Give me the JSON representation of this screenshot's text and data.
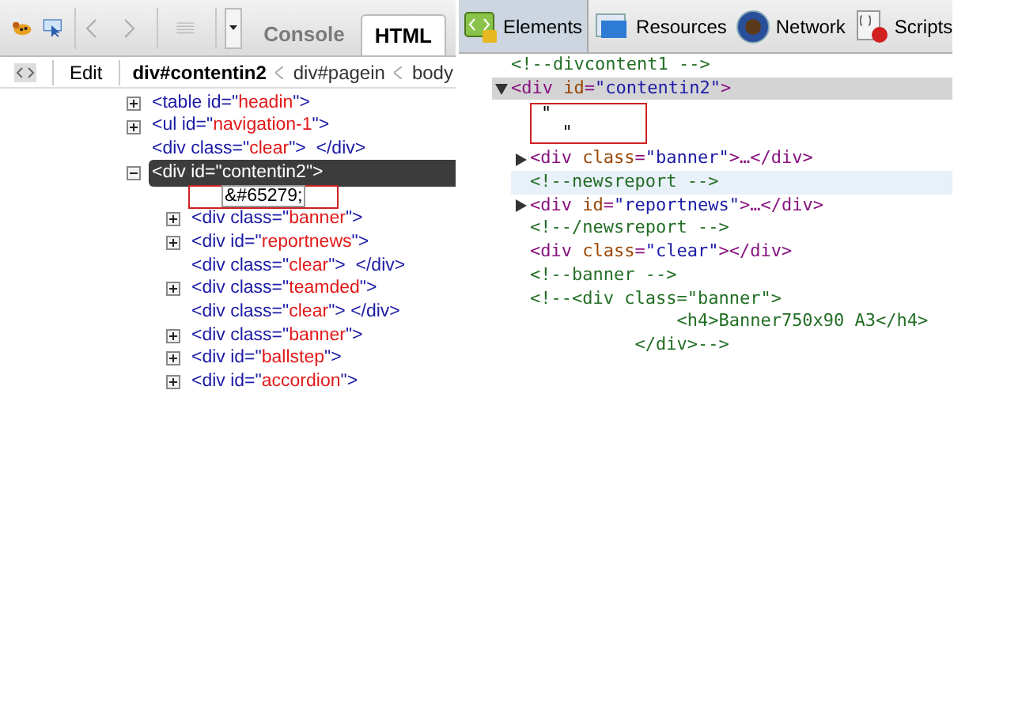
{
  "firebug": {
    "tabs": [
      {
        "label": "Console",
        "selected": false
      },
      {
        "label": "HTML",
        "selected": true
      }
    ],
    "breadcrumb": {
      "edit": "Edit",
      "items": [
        {
          "label": "div#contentin2",
          "selected": true
        },
        {
          "label": "div#pagein",
          "selected": false
        },
        {
          "label": "body",
          "selected": false
        }
      ]
    },
    "tree": [
      {
        "kind": "element",
        "expandable": true,
        "expanded": false,
        "text": "<table id=\"headin\">",
        "selected": false
      },
      {
        "kind": "element",
        "expandable": true,
        "expanded": false,
        "text": "<ul id=\"navigation-1\">",
        "selected": false
      },
      {
        "kind": "element",
        "expandable": false,
        "text": "<div class=\"clear\">  </div>",
        "selected": false
      },
      {
        "kind": "element",
        "expandable": true,
        "expanded": true,
        "text": "<div id=\"contentin2\">",
        "selected": true,
        "children": [
          {
            "kind": "text",
            "text": "&#65279;",
            "marked": true
          },
          {
            "kind": "element",
            "expandable": true,
            "expanded": false,
            "text": "<div class=\"banner\">",
            "selected": false
          },
          {
            "kind": "element",
            "expandable": true,
            "expanded": false,
            "text": "<div id=\"reportnews\">",
            "selected": false
          },
          {
            "kind": "element",
            "expandable": false,
            "text": "<div class=\"clear\">  </div>",
            "selected": false
          },
          {
            "kind": "element",
            "expandable": true,
            "expanded": false,
            "text": "<div class=\"teamded\">",
            "selected": false
          },
          {
            "kind": "element",
            "expandable": false,
            "text": "<div class=\"clear\"> </div>",
            "selected": false
          },
          {
            "kind": "element",
            "expandable": true,
            "expanded": false,
            "text": "<div class=\"banner\">",
            "selected": false
          },
          {
            "kind": "element",
            "expandable": true,
            "expanded": false,
            "text": "<div id=\"ballstep\">",
            "selected": false
          },
          {
            "kind": "element",
            "expandable": true,
            "expanded": false,
            "text": "<div id=\"accordion\">",
            "selected": false
          }
        ]
      }
    ]
  },
  "inspector": {
    "tabs": [
      {
        "label": "Elements",
        "selected": true
      },
      {
        "label": "Resources",
        "selected": false
      },
      {
        "label": "Network",
        "selected": false
      },
      {
        "label": "Scripts",
        "selected": false
      }
    ],
    "tree": [
      {
        "kind": "comment",
        "lines": [
          "<!--divcontent1 -->"
        ],
        "hovered": false
      },
      {
        "kind": "element",
        "expandable": true,
        "expanded": true,
        "text": "<div id=\"contentin2\">",
        "selected": true,
        "children": [
          {
            "kind": "text",
            "lines": [
              "\"",
              "  \""
            ],
            "marked": true
          },
          {
            "kind": "element",
            "expandable": true,
            "expanded": false,
            "text": "<div class=\"banner\">…</div>",
            "selected": false
          },
          {
            "kind": "comment",
            "lines": [
              "<!--newsreport -->"
            ],
            "hovered": true
          },
          {
            "kind": "element",
            "expandable": true,
            "expanded": false,
            "text": "<div id=\"reportnews\">…</div>",
            "selected": false
          },
          {
            "kind": "comment",
            "lines": [
              "<!--/newsreport -->"
            ],
            "hovered": false
          },
          {
            "kind": "element",
            "expandable": false,
            "text": "<div class=\"clear\"></div>",
            "selected": false
          },
          {
            "kind": "comment",
            "lines": [
              "<!--banner -->"
            ],
            "hovered": false
          },
          {
            "kind": "comment",
            "lines": [
              "<!--<div class=\"banner\">",
              "              <h4>Banner750x90 A3</h4>",
              "          </div>-->"
            ],
            "hovered": false
          }
        ]
      }
    ]
  }
}
